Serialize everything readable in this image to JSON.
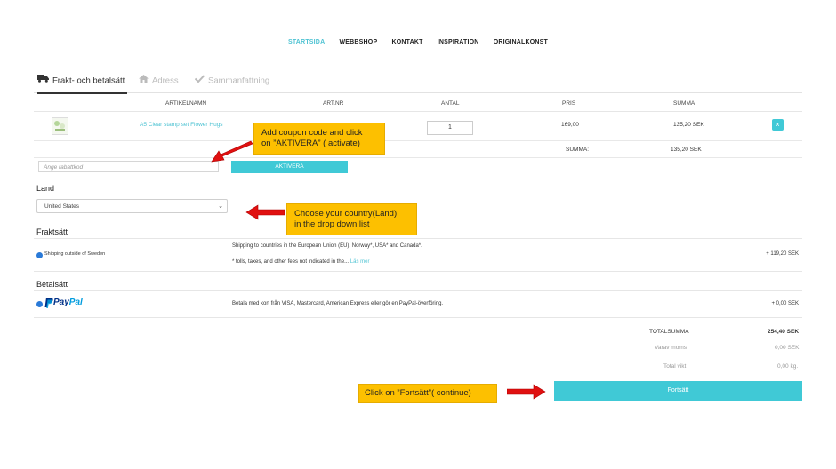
{
  "nav": {
    "items": [
      "STARTSIDA",
      "WEBBSHOP",
      "KONTAKT",
      "INSPIRATION",
      "ORIGINALKONST"
    ],
    "active": 0
  },
  "tabs": [
    {
      "label": "Frakt- och betalsätt",
      "icon": "truck-icon",
      "active": true
    },
    {
      "label": "Adress",
      "icon": "home-icon",
      "active": false
    },
    {
      "label": "Sammanfattning",
      "icon": "check-icon",
      "active": false
    }
  ],
  "cart": {
    "headers": {
      "name": "ARTIKELNAMN",
      "artnr": "ART.NR",
      "qty": "ANTAL",
      "price": "PRIS",
      "sum": "SUMMA"
    },
    "item": {
      "name": "A5 Clear stamp set Flower Hugs",
      "qty": "1",
      "price": "169,00",
      "sum": "135,20 SEK",
      "delete_icon": "x"
    },
    "summa_label": "SUMMA:",
    "summa_value": "135,20 SEK"
  },
  "coupon": {
    "placeholder": "Ange rabattkod",
    "button": "AKTIVERA"
  },
  "land": {
    "title": "Land",
    "selected": "United States"
  },
  "frakt": {
    "title": "Fraktsätt",
    "option": "Shipping outside of Sweden",
    "desc1": "Shipping to countries in the European Union (EU), Norway*, USA* and Canada*.",
    "desc2": "* tolls, taxes, and other fees not indicated in the...",
    "more": "Läs mer",
    "price": "+ 119,20 SEK"
  },
  "betal": {
    "title": "Betalsätt",
    "option": "PayPal",
    "option_pay": "Pay",
    "option_pal": "Pal",
    "desc": "Betala med kort från VISA, Mastercard, American Express eller gör en PayPal-överföring.",
    "price": "+ 0,00 SEK"
  },
  "totals": {
    "total_label": "TOTALSUMMA",
    "total_value": "254,40 SEK",
    "vat_label": "Varav moms",
    "vat_value": "0,00 SEK",
    "weight_label": "Total vikt",
    "weight_value": "0,00 kg."
  },
  "continue_button": "Fortsätt",
  "annotations": {
    "coupon_line1": "Add coupon code and click",
    "coupon_line2": "on ”AKTIVERA” ( activate)",
    "country_line1": "Choose your country(Land)",
    "country_line2": "in the drop down list",
    "continue": "Click on ”Fortsätt”( continue)"
  },
  "colors": {
    "accent": "#40c9d6",
    "note": "#fdc000",
    "arrow": "#e01010",
    "paypal_dark": "#003087",
    "paypal_light": "#009cde"
  }
}
